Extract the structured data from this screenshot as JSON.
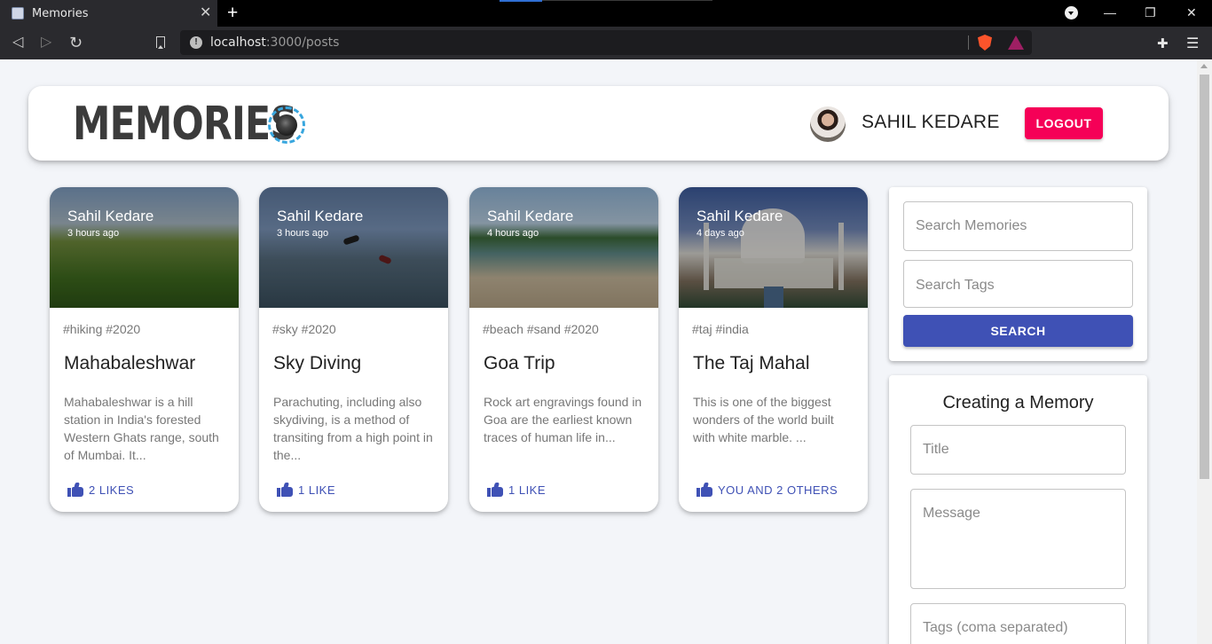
{
  "browser": {
    "tab_title": "Memories",
    "tab_close": "✕",
    "new_tab": "+",
    "url_host": "localhost",
    "url_path": ":3000/posts",
    "win_minimize": "—",
    "win_restore": "❐",
    "win_close": "✕",
    "back": "◁",
    "forward": "▷",
    "reload": "↻",
    "ext": "✚",
    "menu": "☰"
  },
  "header": {
    "logo_text": "MEMORIES",
    "user_name": "SAHIL KEDARE",
    "logout_label": "LOGOUT"
  },
  "posts": [
    {
      "author": "Sahil Kedare",
      "time": "3 hours ago",
      "tags": "#hiking #2020",
      "title": "Mahabaleshwar",
      "message": "Mahabaleshwar is a hill station in India's forested Western Ghats range, south of Mumbai. It...",
      "likes": "2 LIKES"
    },
    {
      "author": "Sahil Kedare",
      "time": "3 hours ago",
      "tags": "#sky #2020",
      "title": "Sky Diving",
      "message": "Parachuting, including also skydiving, is a method of transiting from a high point in the...",
      "likes": "1 LIKE"
    },
    {
      "author": "Sahil Kedare",
      "time": "4 hours ago",
      "tags": "#beach #sand #2020",
      "title": "Goa Trip",
      "message": "Rock art engravings found in Goa are the earliest known traces of human life in...",
      "likes": "1 LIKE"
    },
    {
      "author": "Sahil Kedare",
      "time": "4 days ago",
      "tags": "#taj #india",
      "title": "The Taj Mahal",
      "message": "This is one of the biggest wonders of the world built with white marble. ...",
      "likes": "YOU AND 2 OTHERS"
    }
  ],
  "search": {
    "memories_placeholder": "Search Memories",
    "tags_placeholder": "Search Tags",
    "button_label": "SEARCH"
  },
  "form": {
    "title": "Creating a Memory",
    "title_placeholder": "Title",
    "message_placeholder": "Message",
    "tags_placeholder": "Tags (coma separated)"
  },
  "colors": {
    "primary": "#3f51b5",
    "secondary": "#f50057",
    "background": "#f3f5f9"
  }
}
